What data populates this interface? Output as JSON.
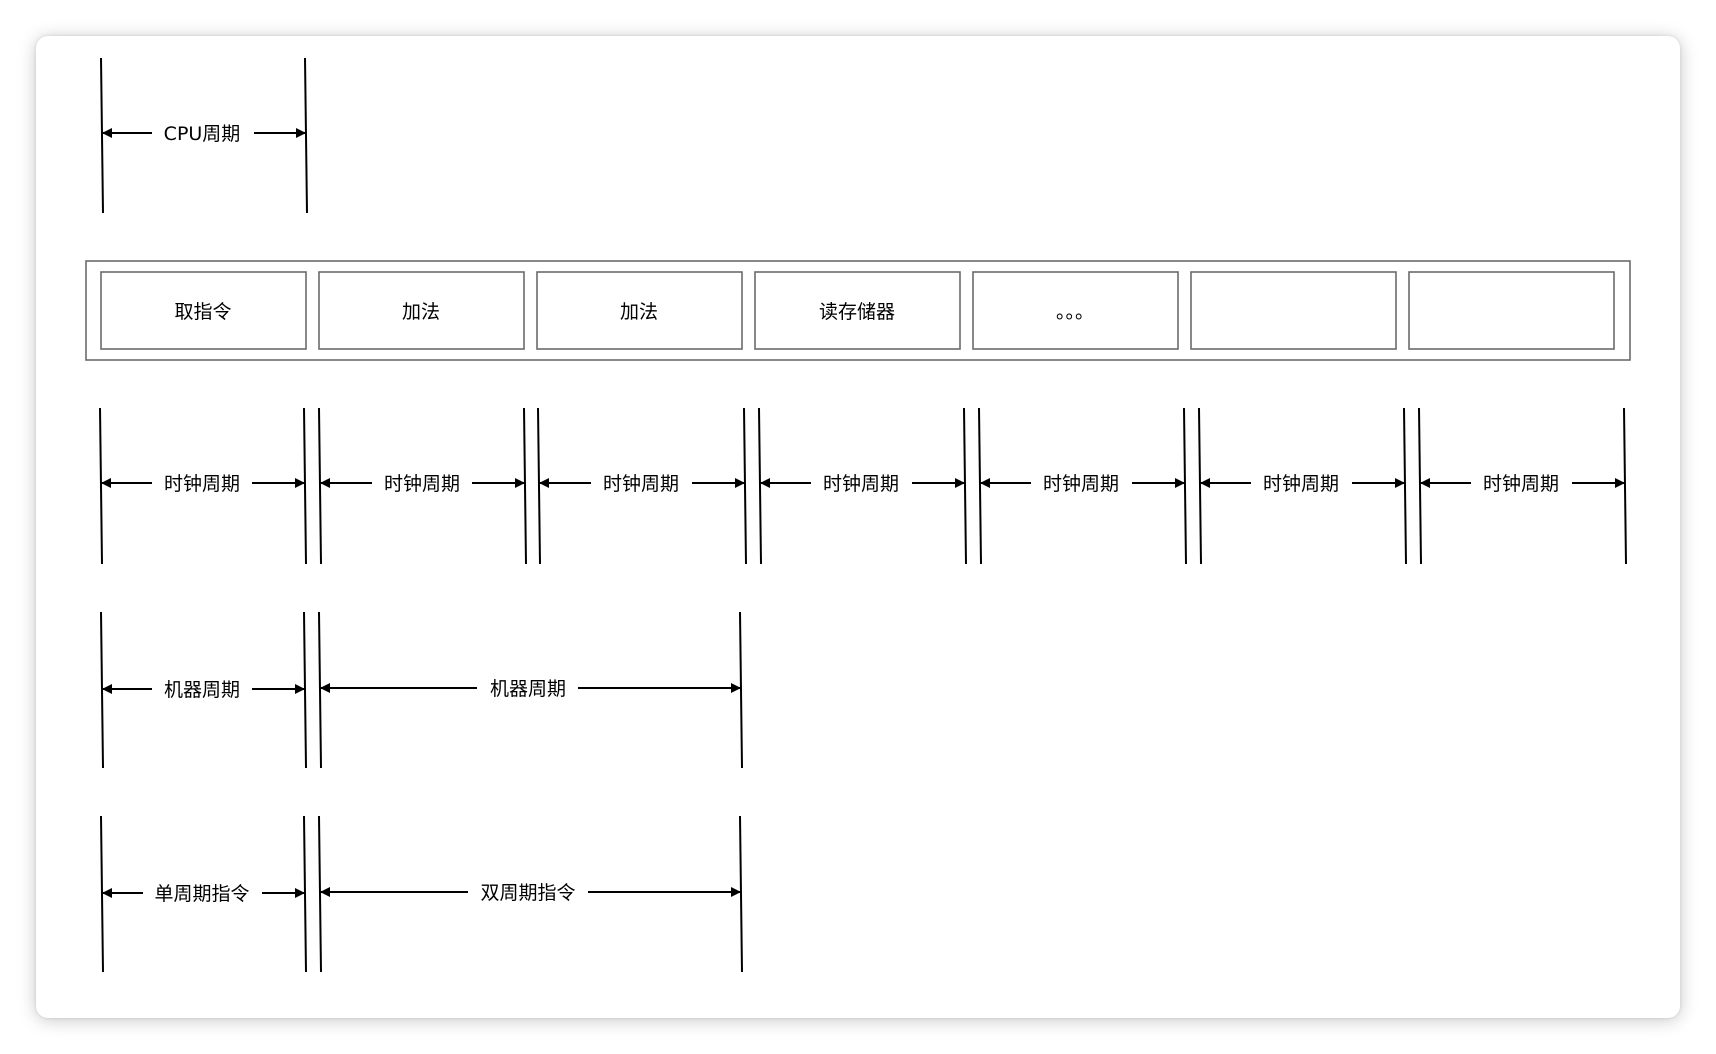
{
  "cpu_cycle": {
    "label": "CPU周期"
  },
  "instruction_blocks": [
    {
      "label": "取指令"
    },
    {
      "label": "加法"
    },
    {
      "label": "加法"
    },
    {
      "label": "读存储器"
    },
    {
      "label": "。。。"
    },
    {
      "label": ""
    },
    {
      "label": ""
    }
  ],
  "clock_cycles": [
    {
      "label": "时钟周期"
    },
    {
      "label": "时钟周期"
    },
    {
      "label": "时钟周期"
    },
    {
      "label": "时钟周期"
    },
    {
      "label": "时钟周期"
    },
    {
      "label": "时钟周期"
    },
    {
      "label": "时钟周期"
    }
  ],
  "machine_cycles": [
    {
      "label": "机器周期"
    },
    {
      "label": "机器周期"
    }
  ],
  "instruction_cycles": [
    {
      "label": "单周期指令"
    },
    {
      "label": "双周期指令"
    }
  ]
}
